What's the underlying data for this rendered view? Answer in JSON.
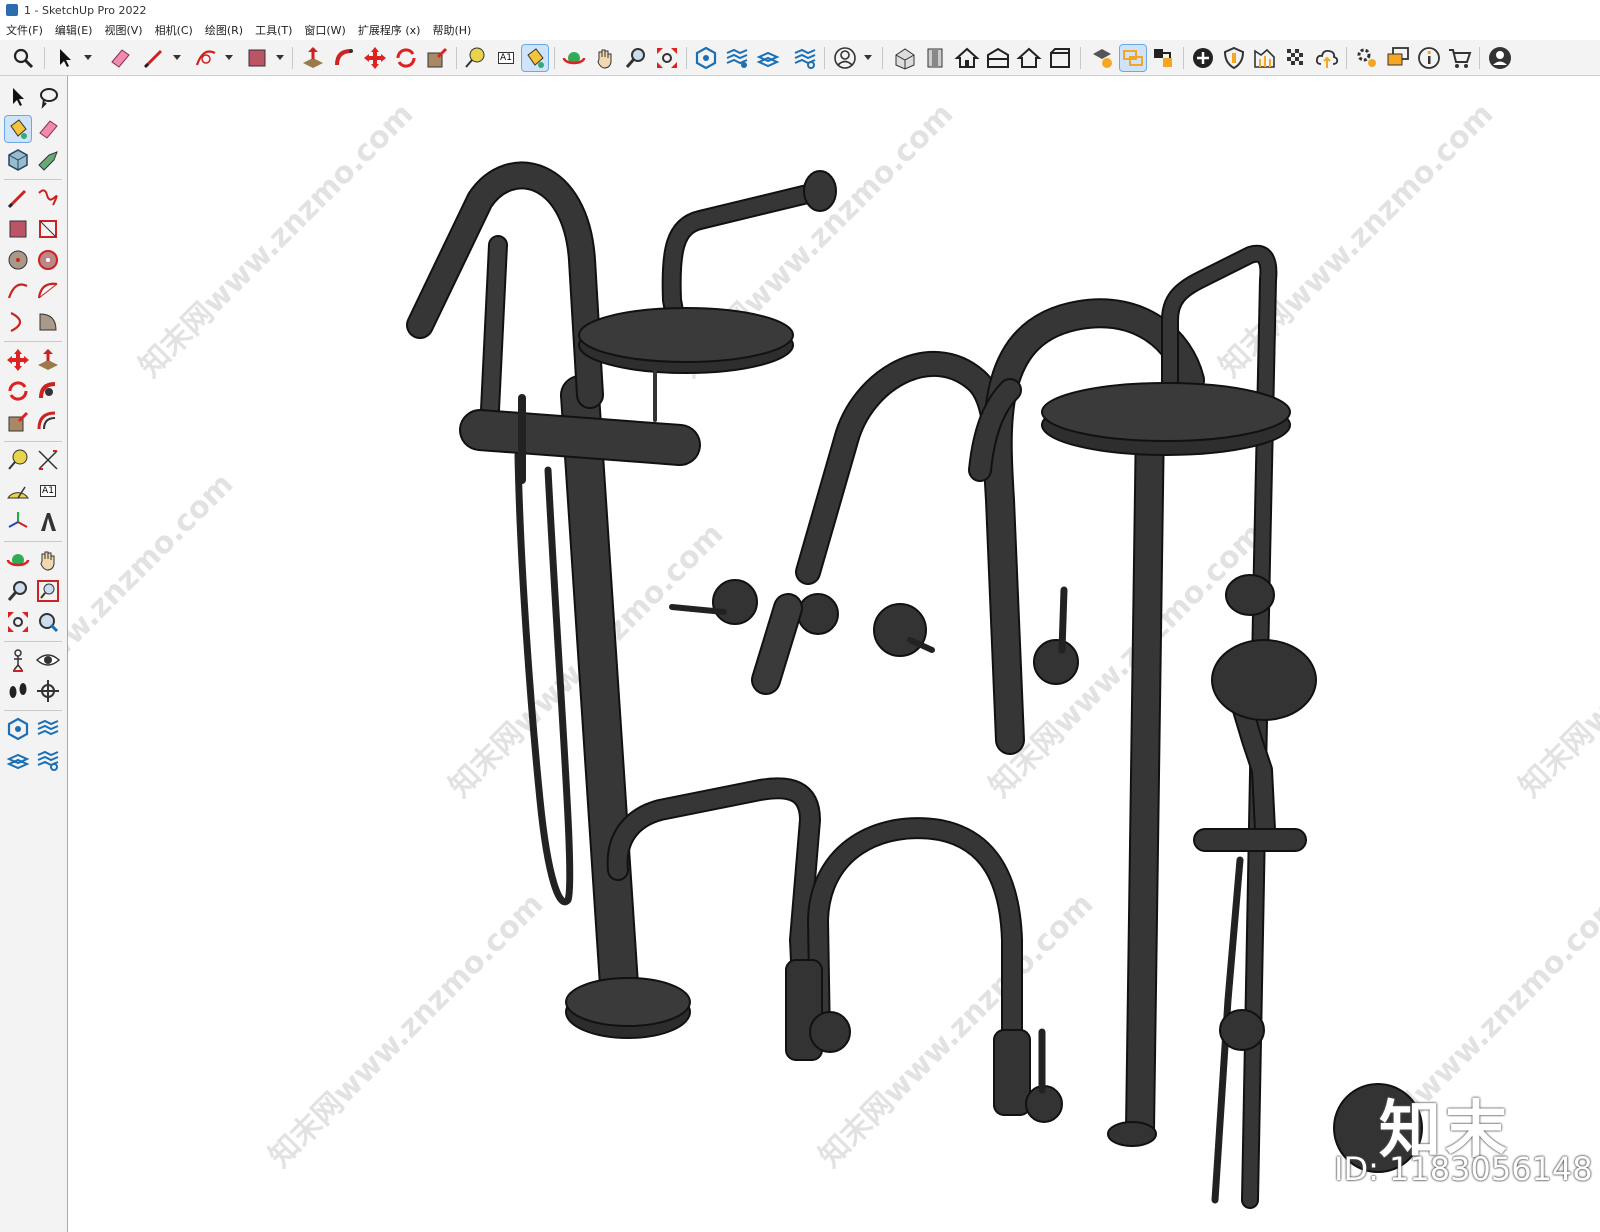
{
  "window": {
    "title": "1 - SketchUp Pro 2022"
  },
  "menu": [
    "文件(F)",
    "编辑(E)",
    "视图(V)",
    "相机(C)",
    "绘图(R)",
    "工具(T)",
    "窗口(W)",
    "扩展程序 (x)",
    "帮助(H)"
  ],
  "toolbar": {
    "text_tool_label": "A1"
  },
  "left_toolbar": {
    "text_tool_label": "A1"
  },
  "watermark": {
    "site_text": "知末网www.znzmo.com",
    "logo_text": "知末",
    "id_text": "ID: 1183056148"
  },
  "colors": {
    "model_fill": "#333333",
    "model_stroke": "#111111",
    "toolbar_bg": "#f3f3f3",
    "active_tool_bg": "#cfe4fa"
  }
}
